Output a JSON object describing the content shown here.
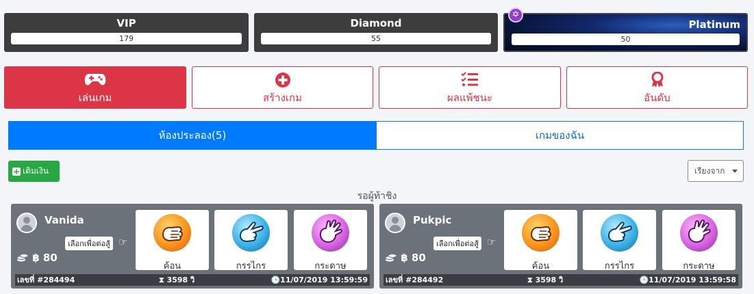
{
  "tiers": [
    {
      "name": "VIP",
      "value": "179"
    },
    {
      "name": "Diamond",
      "value": "55"
    },
    {
      "name": "Platinum",
      "value": "50"
    }
  ],
  "menu": [
    {
      "label": "เล่นเกม",
      "icon": "gamepad-icon"
    },
    {
      "label": "สร้างเกม",
      "icon": "plus-circle-icon"
    },
    {
      "label": "ผลแพ้ชนะ",
      "icon": "checklist-icon"
    },
    {
      "label": "อันดับ",
      "icon": "award-icon"
    }
  ],
  "tabs": [
    {
      "label": "ห้องประลอง(5)"
    },
    {
      "label": "เกมของฉัน"
    }
  ],
  "topup_label": "เติมเงิน",
  "sort_label": "เรียงจาก",
  "waiting_label": "รอผู้ท้าชิง",
  "choices": [
    "ค้อน",
    "กรรไกร",
    "กระดาษ"
  ],
  "games": [
    {
      "player": "Vanida",
      "pick_label": "เลือกเพื่อต่อสู้",
      "bet": "฿ 80",
      "game_id": "เลขที่ #284494",
      "time_left": "3598 วิ",
      "created": "11/07/2019 13:59:59"
    },
    {
      "player": "Pukpic",
      "pick_label": "เลือกเพื่อต่อสู้",
      "bet": "฿ 80",
      "game_id": "เลขที่ #284492",
      "time_left": "3598 วิ",
      "created": "11/07/2019 13:59:58"
    }
  ],
  "colors": {
    "primary": "#007bff",
    "danger": "#dc3545",
    "success": "#28a745",
    "card_bg": "#6c727a"
  }
}
